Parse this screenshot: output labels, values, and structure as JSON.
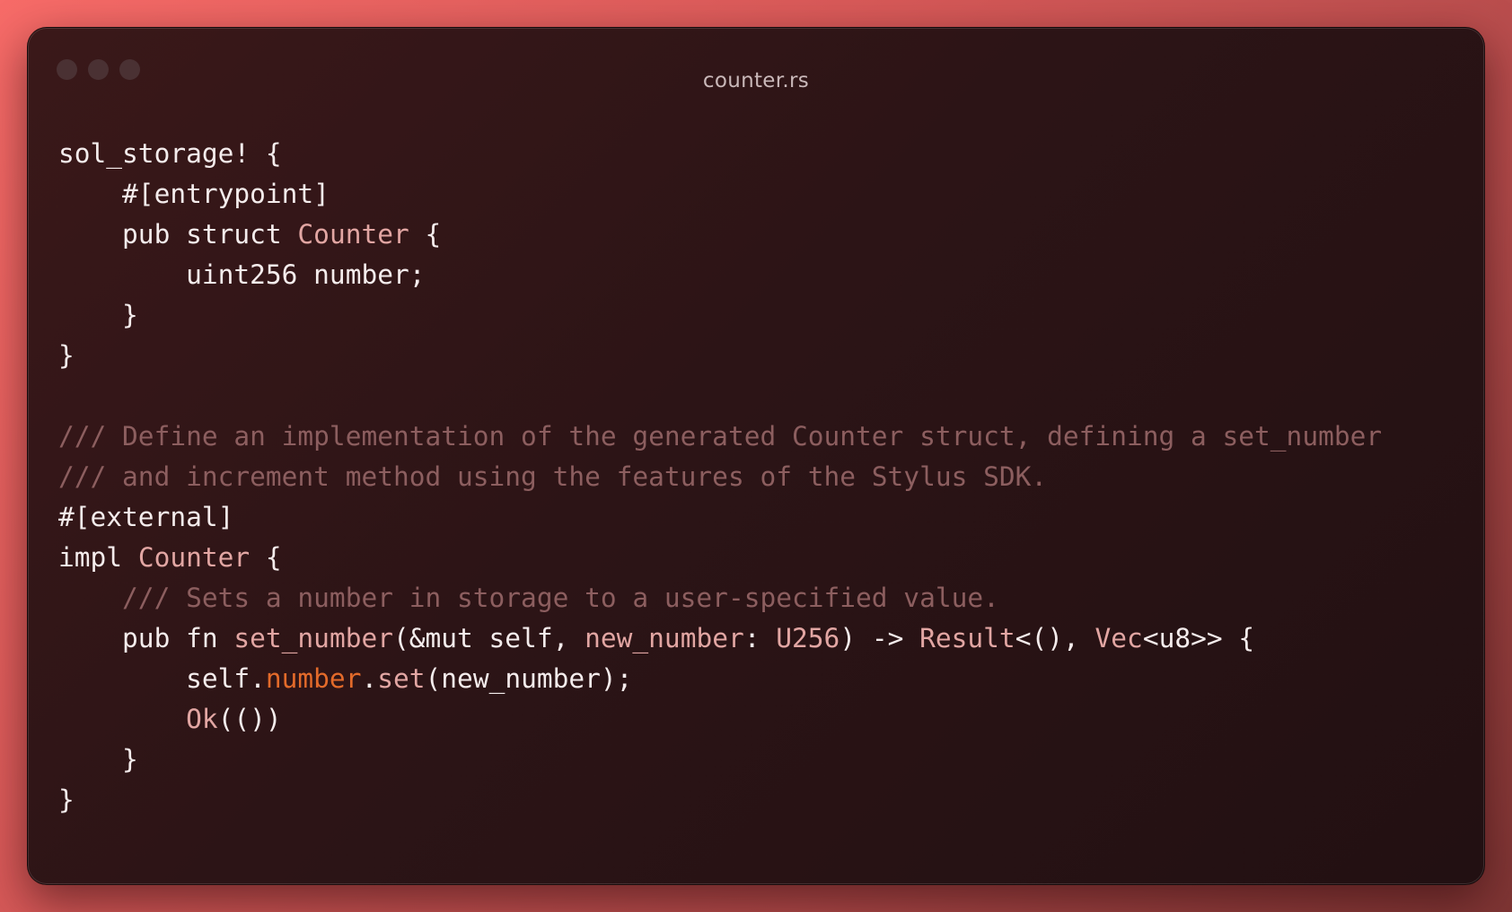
{
  "window": {
    "title": "counter.rs",
    "traffic_lights": [
      "close",
      "minimize",
      "zoom"
    ]
  },
  "colors": {
    "background_gradient": [
      "#f76b68",
      "#7e3534"
    ],
    "window_bg": "#2c1416",
    "text": "#f4ecec",
    "comment": "#8c5e5f",
    "type": "#e2a6a3",
    "field": "#e36a2a"
  },
  "code": [
    [
      {
        "t": "sol_storage! {",
        "k": "plain"
      }
    ],
    [
      {
        "t": "    #[entrypoint]",
        "k": "plain"
      }
    ],
    [
      {
        "t": "    pub struct ",
        "k": "plain"
      },
      {
        "t": "Counter",
        "k": "type"
      },
      {
        "t": " {",
        "k": "plain"
      }
    ],
    [
      {
        "t": "        uint256 number;",
        "k": "plain"
      }
    ],
    [
      {
        "t": "    }",
        "k": "plain"
      }
    ],
    [
      {
        "t": "}",
        "k": "plain"
      }
    ],
    [],
    [
      {
        "t": "/// Define an implementation of the generated Counter struct, defining a set_number",
        "k": "comment"
      }
    ],
    [
      {
        "t": "/// and increment method using the features of the Stylus SDK.",
        "k": "comment"
      }
    ],
    [
      {
        "t": "#[external]",
        "k": "plain"
      }
    ],
    [
      {
        "t": "impl ",
        "k": "plain"
      },
      {
        "t": "Counter",
        "k": "type"
      },
      {
        "t": " {",
        "k": "plain"
      }
    ],
    [
      {
        "t": "    /// Sets a number in storage to a user-specified value.",
        "k": "comment"
      }
    ],
    [
      {
        "t": "    pub fn ",
        "k": "plain"
      },
      {
        "t": "set_number",
        "k": "func"
      },
      {
        "t": "(&mut self, ",
        "k": "plain"
      },
      {
        "t": "new_number",
        "k": "type"
      },
      {
        "t": ": ",
        "k": "plain"
      },
      {
        "t": "U256",
        "k": "type"
      },
      {
        "t": ") -> ",
        "k": "plain"
      },
      {
        "t": "Result",
        "k": "type"
      },
      {
        "t": "<(), ",
        "k": "plain"
      },
      {
        "t": "Vec",
        "k": "type"
      },
      {
        "t": "<u8>> {",
        "k": "plain"
      }
    ],
    [
      {
        "t": "        self.",
        "k": "plain"
      },
      {
        "t": "number",
        "k": "field"
      },
      {
        "t": ".",
        "k": "plain"
      },
      {
        "t": "set",
        "k": "func"
      },
      {
        "t": "(new_number);",
        "k": "plain"
      }
    ],
    [
      {
        "t": "        ",
        "k": "plain"
      },
      {
        "t": "Ok",
        "k": "type"
      },
      {
        "t": "(())",
        "k": "plain"
      }
    ],
    [
      {
        "t": "    }",
        "k": "plain"
      }
    ],
    [
      {
        "t": "}",
        "k": "plain"
      }
    ]
  ]
}
